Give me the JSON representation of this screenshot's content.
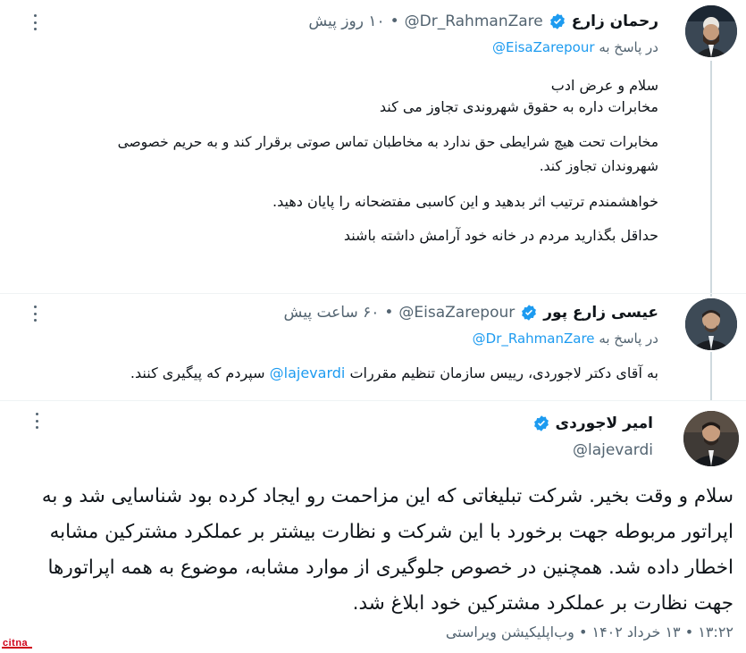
{
  "tweets": [
    {
      "author_name": "رحمان زارع",
      "handle": "@Dr_RahmanZare",
      "time": "۱۰ روز پیش",
      "reply_prefix": "در پاسخ به",
      "reply_to": "@EisaZarepour",
      "paragraphs": [
        "سلام و عرض ادب",
        "مخابرات داره به حقوق شهروندی تجاوز می کند",
        "مخابرات تحت هیچ شرایطی حق ندارد به مخاطبان تماس صوتی برقرار کند و به حریم خصوصی شهروندان تجاوز کند.",
        "خواهشمندم ترتیب اثر بدهید و این کاسبی مفتضحانه را پایان دهید.",
        "حداقل بگذارید مردم در خانه خود آرامش داشته باشند"
      ]
    },
    {
      "author_name": "عیسی زارع پور",
      "handle": "@EisaZarepour",
      "time": "۶۰ ساعت پیش",
      "reply_prefix": "در پاسخ به",
      "reply_to": "@Dr_RahmanZare",
      "text_before": "به آقای دکتر لاجوردی، رییس سازمان تنظیم مقررات",
      "mention": "@lajevardi",
      "text_after": "سپردم که پیگیری کنند."
    },
    {
      "author_name": "امیر لاجوردی",
      "handle": "@lajevardi",
      "text": "سلام و وقت بخیر. شرکت تبلیغاتی که این مزاحمت رو ایجاد کرده بود  شناسایی شد و  به اپراتور مربوطه جهت برخورد با این شرکت و نظارت بیشتر بر عملکرد مشترکین مشابه اخطار داده شد. همچنین در خصوص جلوگیری از موارد مشابه، موضوع به همه اپراتورها جهت نظارت بر عملکرد مشترکین خود ابلاغ شد.",
      "timestamp": "۱۳:۲۲ • ۱۳ خرداد ۱۴۰۲ • وب‌اپلیکیشن ویراستی"
    }
  ],
  "watermark": "citna",
  "colors": {
    "link": "#1d9bf0",
    "muted": "#536471",
    "verified": "#1d9bf0"
  }
}
